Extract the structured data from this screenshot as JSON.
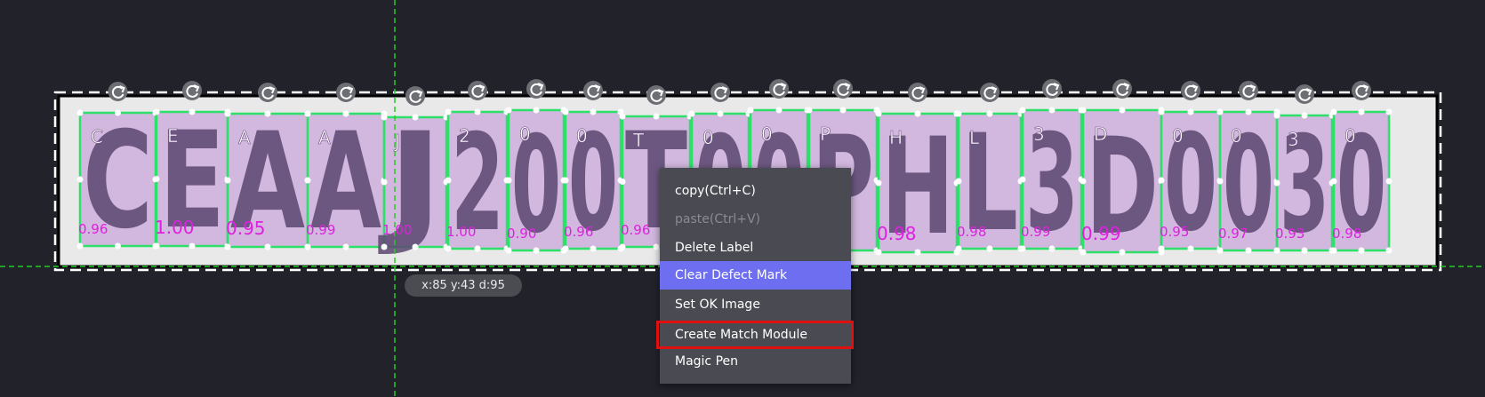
{
  "coordinate_readout": "x:85 y:43 d:95",
  "context_menu": {
    "items": [
      {
        "label": "copy(Ctrl+C)",
        "state": "normal"
      },
      {
        "label": "paste(Ctrl+V)",
        "state": "disabled"
      },
      {
        "label": "Delete Label",
        "state": "normal"
      },
      {
        "label": "Clear Defect Mark",
        "state": "selected"
      },
      {
        "label": "Set OK Image",
        "state": "normal"
      },
      {
        "label": "Create Match Module",
        "state": "outlined"
      },
      {
        "label": "Magic Pen",
        "state": "normal"
      }
    ]
  },
  "image_text": "CEAAJ200T00PHL3D0030",
  "labels": [
    {
      "char": "C",
      "score": "0.96"
    },
    {
      "char": "E",
      "score": "1.00"
    },
    {
      "char": "A",
      "score": "0.95"
    },
    {
      "char": "A",
      "score": "0.99"
    },
    {
      "char": "J",
      "score": "1.00"
    },
    {
      "char": "2",
      "score": "1.00"
    },
    {
      "char": "0",
      "score": "0.90"
    },
    {
      "char": "0",
      "score": "0.96"
    },
    {
      "char": "T",
      "score": "0.96"
    },
    {
      "char": "0",
      "score": ""
    },
    {
      "char": "0",
      "score": ""
    },
    {
      "char": "P",
      "score": ""
    },
    {
      "char": "H",
      "score": "0.98"
    },
    {
      "char": "L",
      "score": "0.98"
    },
    {
      "char": "3",
      "score": "0.99"
    },
    {
      "char": "D",
      "score": "0.99"
    },
    {
      "char": "0",
      "score": "0.95"
    },
    {
      "char": "0",
      "score": "0.97"
    },
    {
      "char": "3",
      "score": "0.93"
    },
    {
      "char": "0",
      "score": "0.98"
    }
  ],
  "colors": {
    "background": "#21222a",
    "crosshair": "#22cc22",
    "box_border": "#2ee06a",
    "label_fill": "#c9a6d9",
    "score_text": "#e020e0",
    "menu_bg": "#4a4b52",
    "menu_selected": "#6e6ef0",
    "highlight_outline": "#e01010"
  },
  "icons": [
    "rotate-handle-icon"
  ]
}
